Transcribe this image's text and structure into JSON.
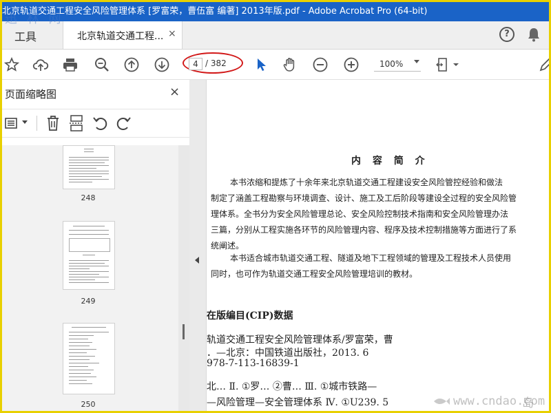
{
  "window": {
    "title": "北京轨道交通工程安全风险管理体系 [罗富荣，曹伍富 编著] 2013年版.pdf - Adobe Acrobat Pro (64-bit)"
  },
  "tabs": {
    "tools_label": "工具",
    "document_label": "北京轨道交通工程...",
    "close_glyph": "×"
  },
  "header": {
    "help_glyph": "?"
  },
  "navigation": {
    "current_page": "4",
    "total_pages": "/ 382"
  },
  "zoom": {
    "value": "100%"
  },
  "sidebar": {
    "title": "页面缩略图",
    "close_glyph": "×",
    "thumbnails": [
      {
        "page_label": "248"
      },
      {
        "page_label": "249"
      },
      {
        "page_label": "250"
      }
    ]
  },
  "document": {
    "heading": "内 容 简 介",
    "paragraph_lines": [
      "本书浓缩和提炼了十余年来北京轨道交通工程建设安全风险管控经验和做法",
      "制定了涵盖工程勘察与环境调查、设计、施工及工后阶段等建设全过程的安全风险管",
      "理体系。全书分为安全风险管理总论、安全风险控制技术指南和安全风险管理办法",
      "三篇，分别从工程实施各环节的风险管理内容、程序及技术控制措施等方面进行了系",
      "统阐述。",
      "本书适合城市轨道交通工程、隧道及地下工程领域的管理及工程技术人员使用",
      "同时，也可作为轨道交通工程安全风险管理培训的教材。"
    ],
    "cip_title": "在版编目(CIP)数据",
    "cip_lines": [
      "轨道交通工程安全风险管理体系/罗富荣，曹",
      "．—北京：中国铁道出版社，2013. 6",
      "978-7-113-16839-1",
      "北…   Ⅱ. ①罗…  ②曹…   Ⅲ. ①城市铁路—",
      "—风险管理—安全管理体系   Ⅳ. ①U239. 5"
    ]
  },
  "watermarks": {
    "top_left": "迅 林 网",
    "bottom_right": "www.cndao.com",
    "logo_text": "岛 网"
  }
}
